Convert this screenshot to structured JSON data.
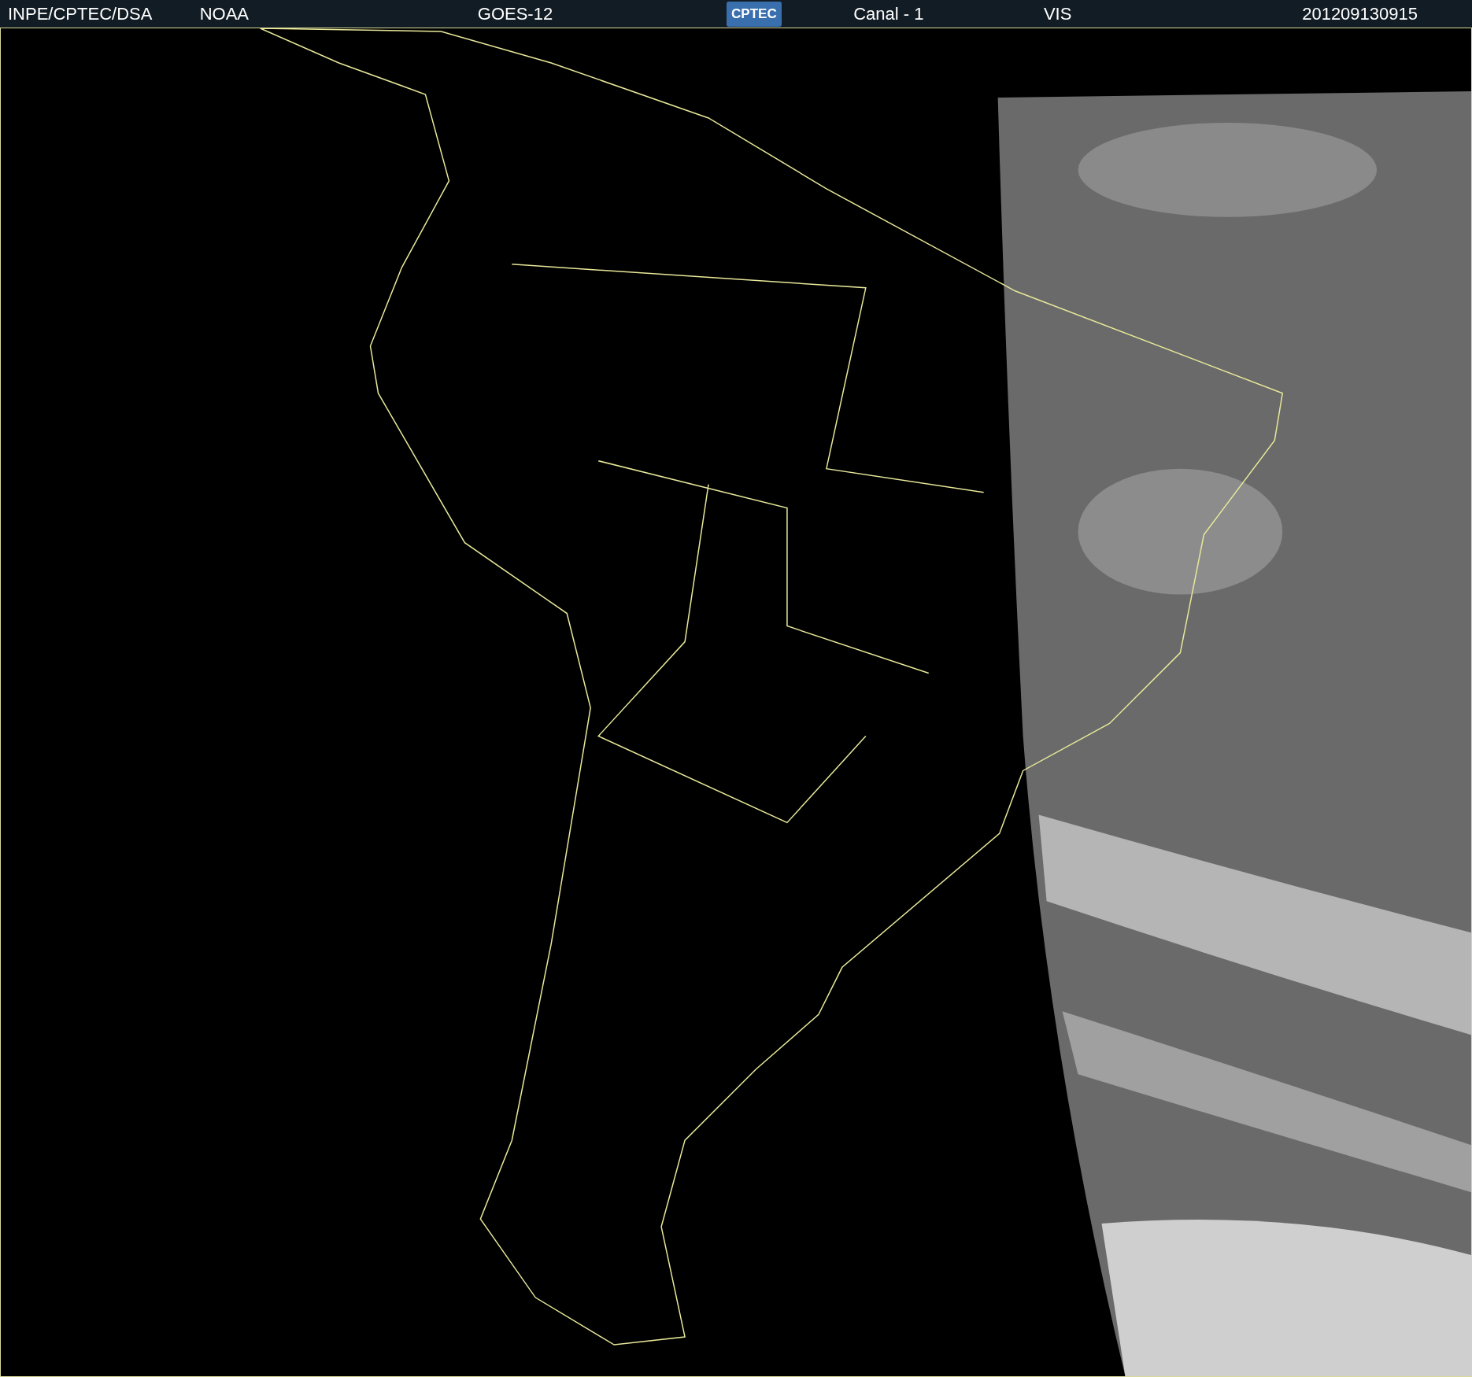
{
  "header": {
    "items": [
      {
        "kind": "text",
        "text": "INPE/CPTEC/DSA"
      },
      {
        "kind": "text",
        "text": "NOAA"
      },
      {
        "kind": "text",
        "text": "GOES-12"
      },
      {
        "kind": "logo",
        "text": "CPTEC"
      },
      {
        "kind": "text",
        "text": "Canal - 1"
      },
      {
        "kind": "text",
        "text": "VIS"
      },
      {
        "kind": "text",
        "text": "201209130915"
      }
    ]
  }
}
